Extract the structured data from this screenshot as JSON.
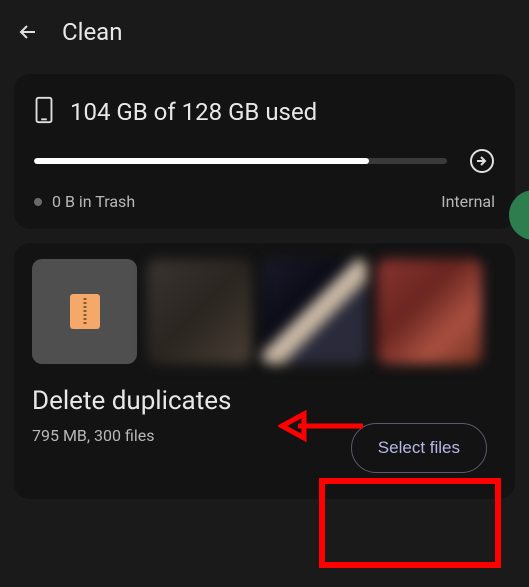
{
  "header": {
    "title": "Clean"
  },
  "storage_card": {
    "usage_text": "104 GB of 128 GB used",
    "fill_percent": 81,
    "trash_text": "0 B in Trash",
    "location_label": "Internal"
  },
  "duplicates_card": {
    "title": "Delete duplicates",
    "subtitle": "795 MB, 300 files",
    "button_label": "Select files"
  }
}
